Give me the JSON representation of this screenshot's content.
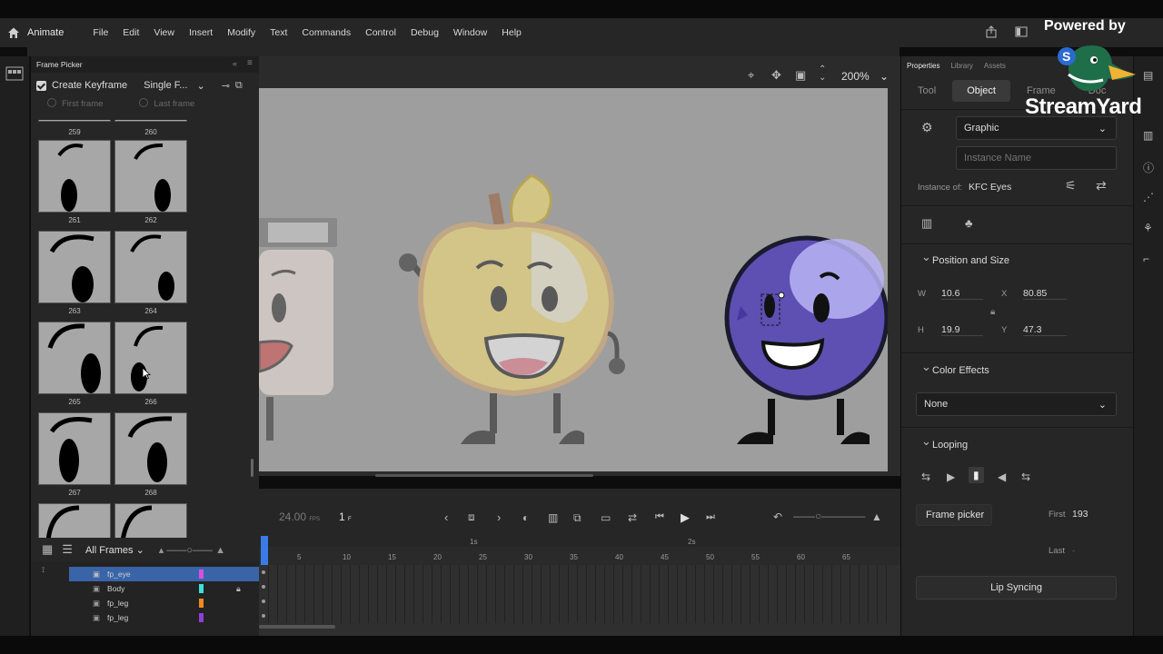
{
  "app": {
    "name": "Animate"
  },
  "menu": [
    "File",
    "Edit",
    "View",
    "Insert",
    "Modify",
    "Text",
    "Commands",
    "Control",
    "Debug",
    "Window",
    "Help"
  ],
  "frame_picker": {
    "title": "Frame Picker",
    "create_keyframe_label": "Create Keyframe",
    "create_keyframe_checked": true,
    "mode_value": "Single F...",
    "first_frame_label": "First frame",
    "last_frame_label": "Last frame",
    "top_labels": [
      "259",
      "260"
    ],
    "thumbs": [
      {
        "labels": [
          "261",
          "262"
        ]
      },
      {
        "labels": [
          "263",
          "264"
        ]
      },
      {
        "labels": [
          "265",
          "266"
        ]
      },
      {
        "labels": [
          "267",
          "268"
        ]
      }
    ]
  },
  "layers": {
    "filter_value": "All Frames",
    "rows": [
      {
        "name": "fp_eye",
        "color": "#d94fe0",
        "selected": true
      },
      {
        "name": "Body",
        "color": "#3ee0d8",
        "locked": true
      },
      {
        "name": "fp_leg",
        "color": "#f08a1e"
      },
      {
        "name": "fp_leg",
        "color": "#8e3fd8"
      }
    ]
  },
  "stage": {
    "zoom": "200%"
  },
  "timeline": {
    "fps": "24.00",
    "fps_unit": "FPS",
    "current_frame": "1",
    "frame_unit": "F",
    "ruler": [
      "5",
      "10",
      "15",
      "20",
      "25",
      "30",
      "35",
      "40",
      "45",
      "50",
      "55",
      "60",
      "65"
    ],
    "seconds": [
      "1s",
      "2s"
    ]
  },
  "properties": {
    "tabs": [
      "Properties",
      "Library",
      "Assets"
    ],
    "subtabs": [
      "Tool",
      "Object",
      "Frame",
      "Doc"
    ],
    "symbol_type": "Graphic",
    "instance_name_placeholder": "Instance Name",
    "instance_of_label": "Instance of:",
    "instance_of_value": "KFC Eyes",
    "position_size": {
      "title": "Position and Size",
      "w_label": "W",
      "w": "10.6",
      "x_label": "X",
      "x": "80.85",
      "h_label": "H",
      "h": "19.9",
      "y_label": "Y",
      "y": "47.3"
    },
    "color_effects": {
      "title": "Color Effects",
      "value": "None"
    },
    "looping": {
      "title": "Looping",
      "frame_picker_label": "Frame picker",
      "first_label": "First",
      "first_value": "193",
      "last_label": "Last",
      "last_value": "-",
      "lip_sync_label": "Lip Syncing"
    }
  },
  "watermark": {
    "powered": "Powered by",
    "brand": "StreamYard"
  }
}
